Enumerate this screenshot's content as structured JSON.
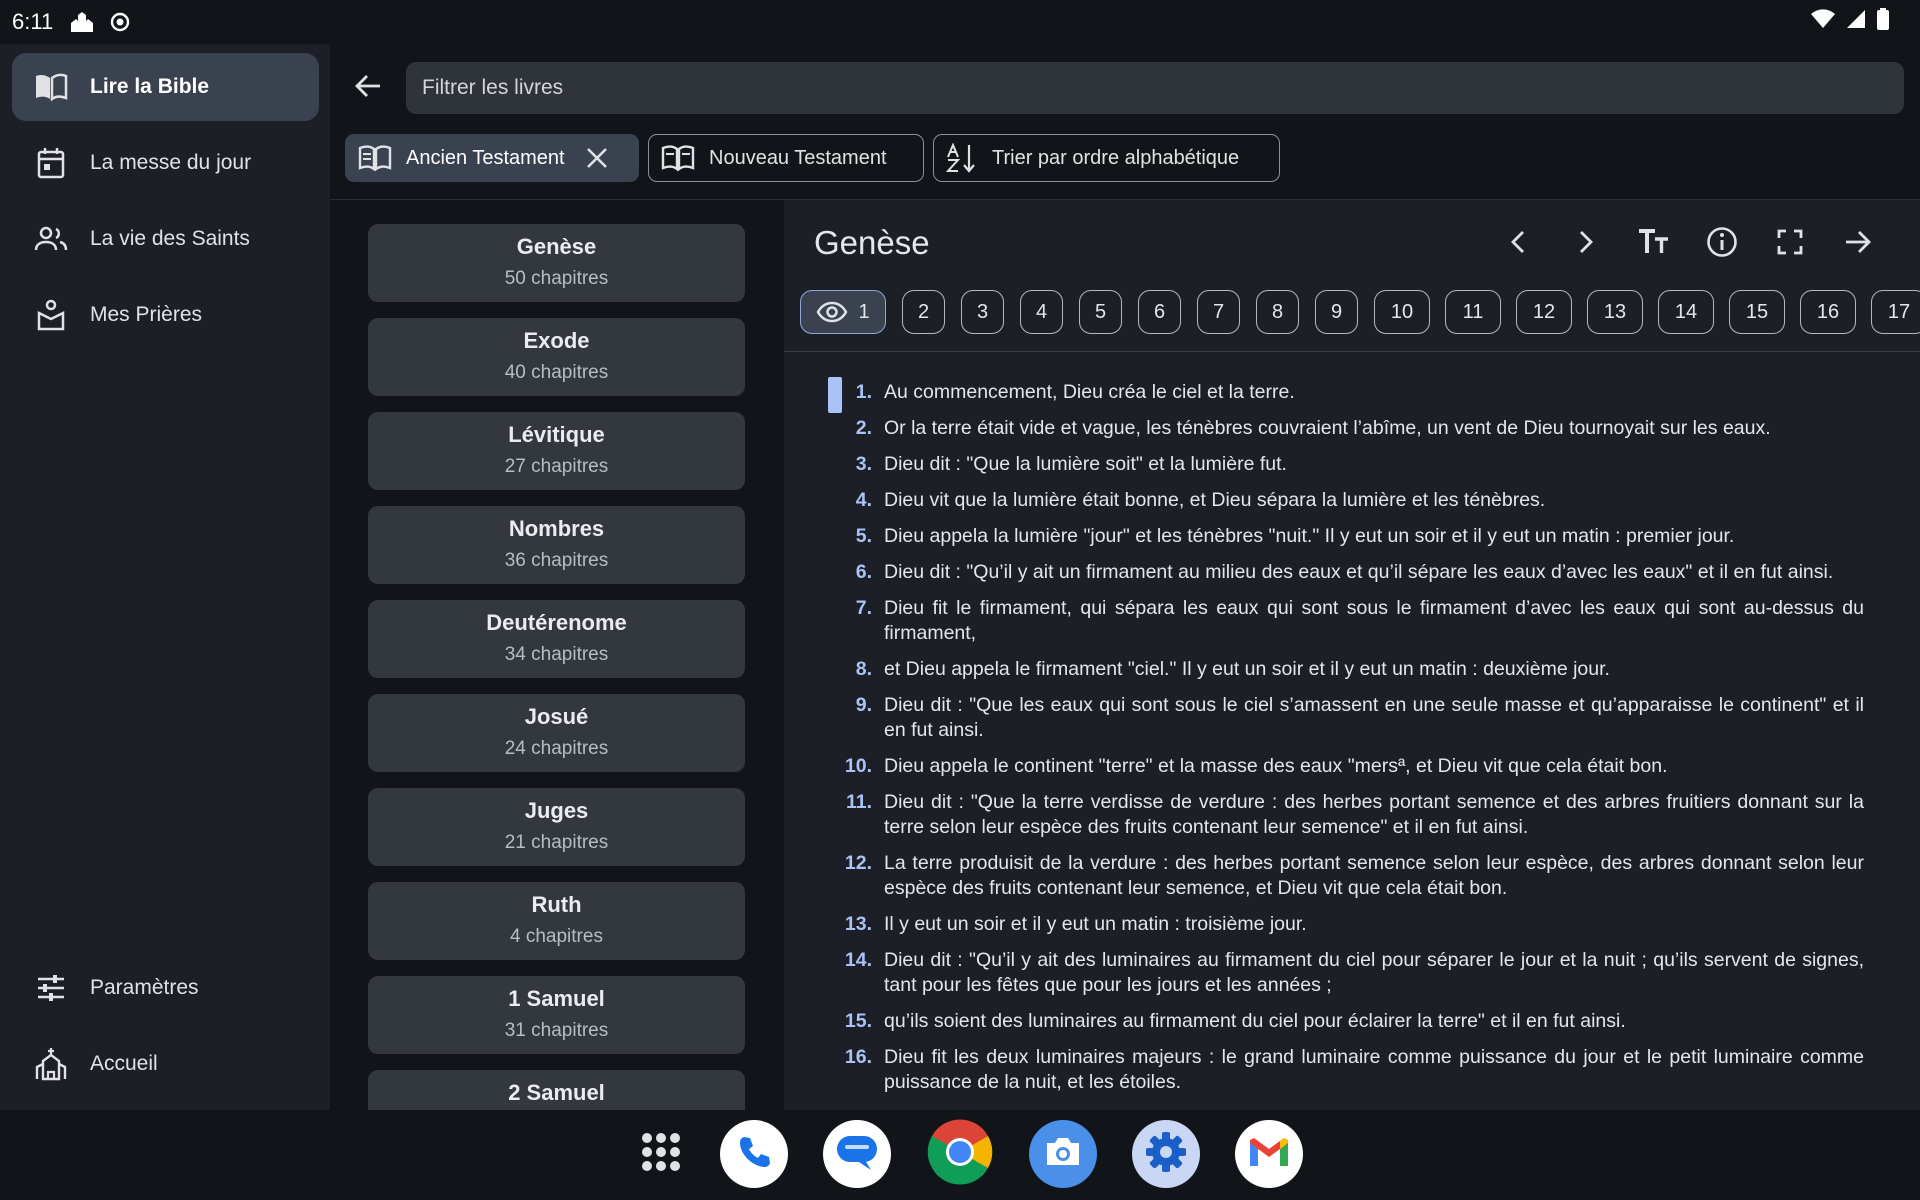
{
  "status_bar": {
    "time": "6:11"
  },
  "drawer": {
    "items": [
      {
        "label": "Lire la Bible",
        "icon": "book-open-icon",
        "active": true
      },
      {
        "label": "La messe du jour",
        "icon": "calendar-icon"
      },
      {
        "label": "La vie des Saints",
        "icon": "people-icon"
      },
      {
        "label": "Mes Prières",
        "icon": "praying-hands-icon"
      }
    ],
    "bottom_items": [
      {
        "label": "Paramètres",
        "icon": "sliders-icon"
      },
      {
        "label": "Accueil",
        "icon": "church-icon"
      }
    ]
  },
  "search": {
    "placeholder": "Filtrer les livres"
  },
  "filters": {
    "old_testament": "Ancien Testament",
    "new_testament": "Nouveau Testament",
    "sort": "Trier par ordre alphabétique"
  },
  "books": [
    {
      "name": "Genèse",
      "chapters": "50 chapitres"
    },
    {
      "name": "Exode",
      "chapters": "40 chapitres"
    },
    {
      "name": "Lévitique",
      "chapters": "27 chapitres"
    },
    {
      "name": "Nombres",
      "chapters": "36 chapitres"
    },
    {
      "name": "Deutérenome",
      "chapters": "34 chapitres"
    },
    {
      "name": "Josué",
      "chapters": "24 chapitres"
    },
    {
      "name": "Juges",
      "chapters": "21 chapitres"
    },
    {
      "name": "Ruth",
      "chapters": "4 chapitres"
    },
    {
      "name": "1 Samuel",
      "chapters": "31 chapitres"
    },
    {
      "name": "2 Samuel",
      "chapters": ""
    }
  ],
  "reader": {
    "title": "Genèse",
    "current_chapter": "1",
    "chapters": [
      "2",
      "3",
      "4",
      "5",
      "6",
      "7",
      "8",
      "9",
      "10",
      "11",
      "12",
      "13",
      "14",
      "15",
      "16",
      "17"
    ],
    "verses": [
      {
        "n": "1.",
        "t": "Au commencement, Dieu créa le ciel et la terre."
      },
      {
        "n": "2.",
        "t": "Or la terre était vide et vague, les ténèbres couvraient l’abîme, un vent de Dieu tournoyait sur les eaux."
      },
      {
        "n": "3.",
        "t": "Dieu dit : \"Que la lumière soit\" et la lumière fut."
      },
      {
        "n": "4.",
        "t": "Dieu vit que la lumière était bonne, et Dieu sépara la lumière et les ténèbres."
      },
      {
        "n": "5.",
        "t": "Dieu appela la lumière \"jour\" et les ténèbres \"nuit.\" Il y eut un soir et il y eut un matin : premier jour."
      },
      {
        "n": "6.",
        "t": "Dieu dit : \"Qu’il y ait un firmament au milieu des eaux et qu’il sépare les eaux d’avec les eaux\" et il en fut ainsi."
      },
      {
        "n": "7.",
        "t": "Dieu fit le firmament, qui sépara les eaux qui sont sous le firmament d’avec les eaux qui sont au-dessus du firmament,"
      },
      {
        "n": "8.",
        "t": "et Dieu appela le firmament \"ciel.\" Il y eut un soir et il y eut un matin : deuxième jour."
      },
      {
        "n": "9.",
        "t": "Dieu dit : \"Que les eaux qui sont sous le ciel s’amassent en une seule masse et qu’apparaisse le continent\" et il en fut ainsi."
      },
      {
        "n": "10.",
        "t": "Dieu appela le continent \"terre\" et la masse des eaux \"mersª, et Dieu vit que cela était bon."
      },
      {
        "n": "11.",
        "t": "Dieu dit : \"Que la terre verdisse de verdure : des herbes portant semence et des arbres fruitiers donnant sur la terre selon leur espèce des fruits contenant leur semence\" et il en fut ainsi."
      },
      {
        "n": "12.",
        "t": "La terre produisit de la verdure : des herbes portant semence selon leur espèce, des arbres donnant selon leur espèce des fruits contenant leur semence, et Dieu vit que cela était bon."
      },
      {
        "n": "13.",
        "t": "Il y eut un soir et il y eut un matin : troisième jour."
      },
      {
        "n": "14.",
        "t": "Dieu dit : \"Qu’il y ait des luminaires au firmament du ciel pour séparer le jour et la nuit ; qu’ils servent de signes, tant pour les fêtes que pour les jours et les années ;"
      },
      {
        "n": "15.",
        "t": "qu’ils soient des luminaires au firmament du ciel pour éclairer la terre\" et il en fut ainsi."
      },
      {
        "n": "16.",
        "t": "Dieu fit les deux luminaires majeurs : le grand luminaire comme puissance du jour et le petit luminaire comme puissance de la nuit, et les étoiles."
      }
    ]
  },
  "dock": [
    "apps-grid-icon",
    "phone-icon",
    "messages-icon",
    "chrome-icon",
    "camera-icon",
    "settings-icon",
    "gmail-icon"
  ],
  "colors": {
    "accent": "#a9c3f7",
    "surface": "#1c1f25",
    "background": "#111418",
    "selected": "#3a4250"
  }
}
